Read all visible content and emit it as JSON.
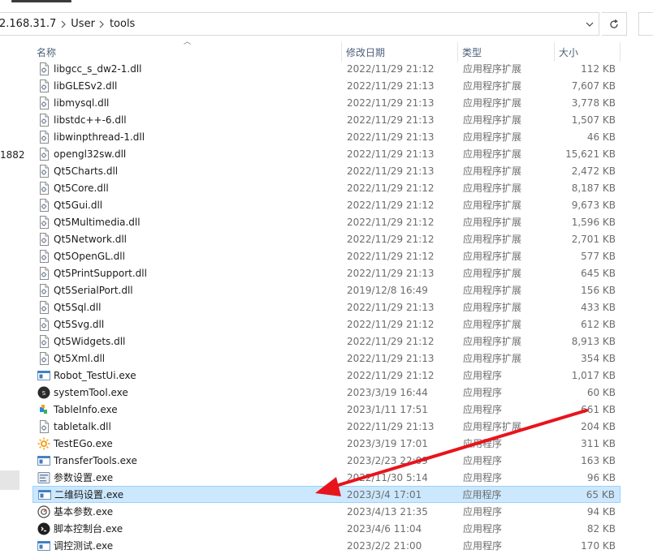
{
  "address": {
    "crumbs": [
      "2.168.31.7",
      "User",
      "tools"
    ]
  },
  "nav": {
    "partial_text": "1882"
  },
  "columns": {
    "name": "名称",
    "date": "修改日期",
    "type": "类型",
    "size": "大小"
  },
  "files": [
    {
      "name": "libgcc_s_dw2-1.dll",
      "date": "2022/11/29 21:12",
      "type": "应用程序扩展",
      "size": "112 KB",
      "icon": "dll-icon"
    },
    {
      "name": "libGLESv2.dll",
      "date": "2022/11/29 21:13",
      "type": "应用程序扩展",
      "size": "7,607 KB",
      "icon": "dll-icon"
    },
    {
      "name": "libmysql.dll",
      "date": "2022/11/29 21:13",
      "type": "应用程序扩展",
      "size": "3,778 KB",
      "icon": "dll-icon"
    },
    {
      "name": "libstdc++-6.dll",
      "date": "2022/11/29 21:13",
      "type": "应用程序扩展",
      "size": "1,507 KB",
      "icon": "dll-icon"
    },
    {
      "name": "libwinpthread-1.dll",
      "date": "2022/11/29 21:13",
      "type": "应用程序扩展",
      "size": "46 KB",
      "icon": "dll-icon"
    },
    {
      "name": "opengl32sw.dll",
      "date": "2022/11/29 21:13",
      "type": "应用程序扩展",
      "size": "15,621 KB",
      "icon": "dll-icon"
    },
    {
      "name": "Qt5Charts.dll",
      "date": "2022/11/29 21:13",
      "type": "应用程序扩展",
      "size": "2,472 KB",
      "icon": "dll-icon"
    },
    {
      "name": "Qt5Core.dll",
      "date": "2022/11/29 21:12",
      "type": "应用程序扩展",
      "size": "8,187 KB",
      "icon": "dll-icon"
    },
    {
      "name": "Qt5Gui.dll",
      "date": "2022/11/29 21:12",
      "type": "应用程序扩展",
      "size": "9,673 KB",
      "icon": "dll-icon"
    },
    {
      "name": "Qt5Multimedia.dll",
      "date": "2022/11/29 21:12",
      "type": "应用程序扩展",
      "size": "1,596 KB",
      "icon": "dll-icon"
    },
    {
      "name": "Qt5Network.dll",
      "date": "2022/11/29 21:12",
      "type": "应用程序扩展",
      "size": "2,701 KB",
      "icon": "dll-icon"
    },
    {
      "name": "Qt5OpenGL.dll",
      "date": "2022/11/29 21:12",
      "type": "应用程序扩展",
      "size": "577 KB",
      "icon": "dll-icon"
    },
    {
      "name": "Qt5PrintSupport.dll",
      "date": "2022/11/29 21:13",
      "type": "应用程序扩展",
      "size": "645 KB",
      "icon": "dll-icon"
    },
    {
      "name": "Qt5SerialPort.dll",
      "date": "2019/12/8 16:49",
      "type": "应用程序扩展",
      "size": "156 KB",
      "icon": "dll-icon"
    },
    {
      "name": "Qt5Sql.dll",
      "date": "2022/11/29 21:13",
      "type": "应用程序扩展",
      "size": "433 KB",
      "icon": "dll-icon"
    },
    {
      "name": "Qt5Svg.dll",
      "date": "2022/11/29 21:12",
      "type": "应用程序扩展",
      "size": "612 KB",
      "icon": "dll-icon"
    },
    {
      "name": "Qt5Widgets.dll",
      "date": "2022/11/29 21:12",
      "type": "应用程序扩展",
      "size": "8,913 KB",
      "icon": "dll-icon"
    },
    {
      "name": "Qt5Xml.dll",
      "date": "2022/11/29 21:13",
      "type": "应用程序扩展",
      "size": "354 KB",
      "icon": "dll-icon"
    },
    {
      "name": "Robot_TestUi.exe",
      "date": "2022/11/29 21:12",
      "type": "应用程序",
      "size": "1,017 KB",
      "icon": "exe-window-icon"
    },
    {
      "name": "systemTool.exe",
      "date": "2023/3/19 16:44",
      "type": "应用程序",
      "size": "60 KB",
      "icon": "system-tool-icon"
    },
    {
      "name": "TableInfo.exe",
      "date": "2023/1/11 17:51",
      "type": "应用程序",
      "size": "661 KB",
      "icon": "tableinfo-icon"
    },
    {
      "name": "tabletalk.dll",
      "date": "2022/11/29 21:13",
      "type": "应用程序扩展",
      "size": "204 KB",
      "icon": "dll-icon"
    },
    {
      "name": "TestEGo.exe",
      "date": "2023/3/19 17:01",
      "type": "应用程序",
      "size": "311 KB",
      "icon": "sun-gear-icon"
    },
    {
      "name": "TransferTools.exe",
      "date": "2023/2/23 22:09",
      "type": "应用程序",
      "size": "163 KB",
      "icon": "exe-window-icon"
    },
    {
      "name": "参数设置.exe",
      "date": "2022/11/30 5:14",
      "type": "应用程序",
      "size": "96 KB",
      "icon": "settings-app-icon"
    },
    {
      "name": "二维码设置.exe",
      "date": "2023/3/4 17:01",
      "type": "应用程序",
      "size": "65 KB",
      "icon": "exe-window-icon",
      "selected": true
    },
    {
      "name": "基本参数.exe",
      "date": "2023/4/13 21:35",
      "type": "应用程序",
      "size": "94 KB",
      "icon": "gauge-icon"
    },
    {
      "name": "脚本控制台.exe",
      "date": "2023/4/6 11:04",
      "type": "应用程序",
      "size": "82 KB",
      "icon": "console-icon"
    },
    {
      "name": "调控测试.exe",
      "date": "2023/2/2 21:00",
      "type": "应用程序",
      "size": "170 KB",
      "icon": "exe-window-icon"
    }
  ],
  "annotation": {
    "arrow_color": "#e8141b"
  }
}
